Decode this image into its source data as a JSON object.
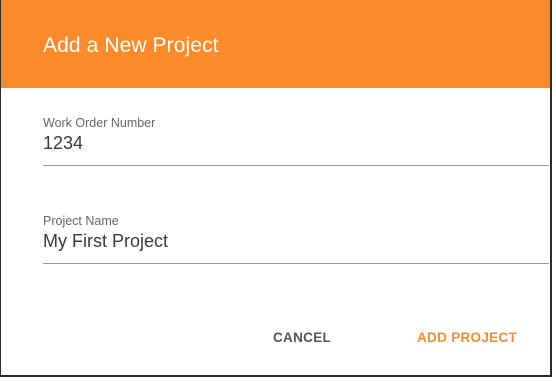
{
  "dialog": {
    "title": "Add a New Project",
    "fields": {
      "work_order": {
        "label": "Work Order Number",
        "value": "1234"
      },
      "project_name": {
        "label": "Project Name",
        "value": "My First Project"
      }
    },
    "actions": {
      "cancel_label": "CANCEL",
      "add_label": "ADD PROJECT"
    }
  },
  "colors": {
    "accent": "#fb8a2a",
    "header_text": "#ffffff"
  }
}
